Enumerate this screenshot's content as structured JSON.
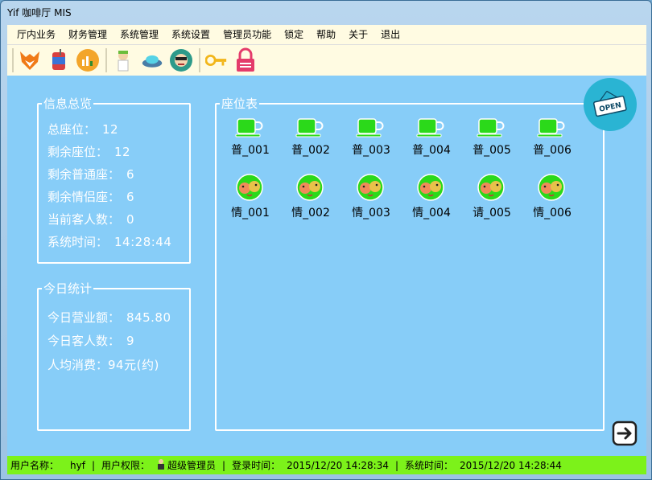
{
  "window": {
    "title": "Yif 咖啡厅 MIS"
  },
  "menu": [
    "厅内业务",
    "财务管理",
    "系统管理",
    "系统设置",
    "管理员功能",
    "锁定",
    "帮助",
    "关于",
    "退出"
  ],
  "toolbar": {
    "icons": [
      "fox-icon",
      "drink-cup-icon",
      "chart-coin-icon",
      "waiter-icon",
      "ufo-button-icon",
      "face-icon",
      "key-icon",
      "lock-icon"
    ]
  },
  "info_overview": {
    "title": "信息总览",
    "rows": [
      {
        "label": "总座位：",
        "value": "12"
      },
      {
        "label": "剩余座位：",
        "value": "12"
      },
      {
        "label": "剩余普通座：",
        "value": "6"
      },
      {
        "label": "剩余情侣座：",
        "value": "6"
      },
      {
        "label": "当前客人数：",
        "value": "0"
      },
      {
        "label": "系统时间：",
        "value": "14:28:44"
      }
    ]
  },
  "today_stats": {
    "title": "今日统计",
    "rows": [
      {
        "label": "今日营业额：",
        "value": "845.80"
      },
      {
        "label": "今日客人数：",
        "value": "9"
      },
      {
        "label": "人均消费：",
        "value": "94元(约)"
      }
    ]
  },
  "seat_table": {
    "title": "座位表",
    "normal_seats": [
      "普_001",
      "普_002",
      "普_003",
      "普_004",
      "普_005",
      "普_006"
    ],
    "lover_seats": [
      "情_001",
      "情_002",
      "情_003",
      "情_004",
      "请_005",
      "情_006"
    ]
  },
  "open_sign": "OPEN",
  "statusbar": {
    "user_label": "用户名称：",
    "user_value": "hyf",
    "perm_label": "用户权限：",
    "perm_value": "超级管理员",
    "login_label": "登录时间：",
    "login_value": "2015/12/20 14:28:34",
    "sys_label": "系统时间：",
    "sys_value": "2015/12/20 14:28:44",
    "sep": "|"
  },
  "colors": {
    "client_bg": "#87cdf8",
    "status_bg": "#7cf21a",
    "cup_green": "#2bd91a",
    "open_badge": "#2ab4d3"
  }
}
